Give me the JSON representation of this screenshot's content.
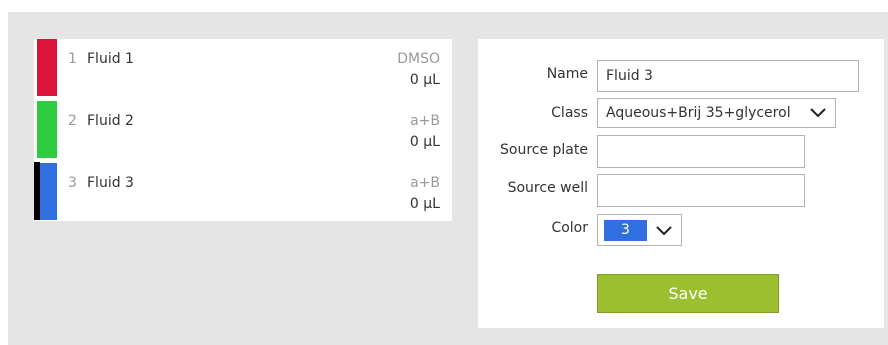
{
  "fluids": [
    {
      "index": "1",
      "name": "Fluid 1",
      "class": "DMSO",
      "volume": "0 µL",
      "color": "#dc143c",
      "selected": false
    },
    {
      "index": "2",
      "name": "Fluid 2",
      "class": "a+B",
      "volume": "0 µL",
      "color": "#2ecc40",
      "selected": false
    },
    {
      "index": "3",
      "name": "Fluid 3",
      "class": "a+B",
      "volume": "0 µL",
      "color": "#2f6fe0",
      "selected": true
    }
  ],
  "form": {
    "name_label": "Name",
    "name_value": "Fluid 3",
    "class_label": "Class",
    "class_value": "Aqueous+Brij 35+glycerol",
    "source_plate_label": "Source plate",
    "source_plate_value": "",
    "source_well_label": "Source well",
    "source_well_value": "",
    "color_label": "Color",
    "color_value": "3",
    "color_hex": "#2f6fe0",
    "save_label": "Save"
  },
  "colors": {
    "save_button": "#9bbf2f",
    "panel_background": "#e5e5e5"
  }
}
